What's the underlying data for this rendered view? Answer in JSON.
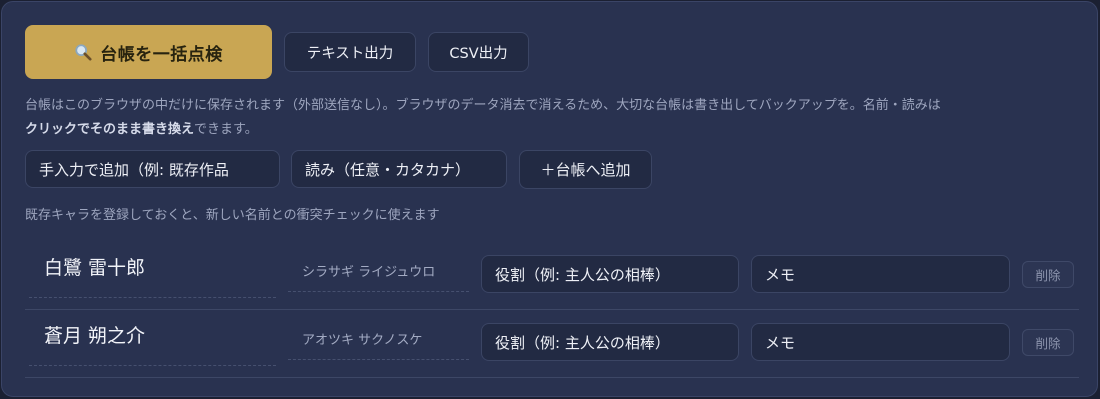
{
  "toolbar": {
    "bulk_check_label": "台帳を一括点検",
    "text_export_label": "テキスト出力",
    "csv_export_label": "CSV出力"
  },
  "info": {
    "line1": "台帳はこのブラウザの中だけに保存されます（外部送信なし）。ブラウザのデータ消去で消えるため、大切な台帳は書き出してバックアップを。名前・読みは",
    "bold": "クリックでそのまま書き換え",
    "line2_rest": "できます。"
  },
  "add_form": {
    "name_placeholder": "手入力で追加（例: 既存作品",
    "reading_placeholder": "読み（任意・カタカナ）",
    "add_label": "＋台帳へ追加"
  },
  "hint": "既存キャラを登録しておくと、新しい名前との衝突チェックに使えます",
  "characters": [
    {
      "name": "白鷺 雷十郎",
      "reading": "シラサギ ライジュウロ",
      "role_placeholder": "役割（例: 主人公の相棒）",
      "memo_placeholder": "メモ",
      "delete_label": "削除"
    },
    {
      "name": "蒼月 朔之介",
      "reading": "アオツキ サクノスケ",
      "role_placeholder": "役割（例: 主人公の相棒）",
      "memo_placeholder": "メモ",
      "delete_label": "削除"
    }
  ],
  "colors": {
    "accent": "#c9a653",
    "panel": "#293250",
    "field": "#222a43"
  }
}
